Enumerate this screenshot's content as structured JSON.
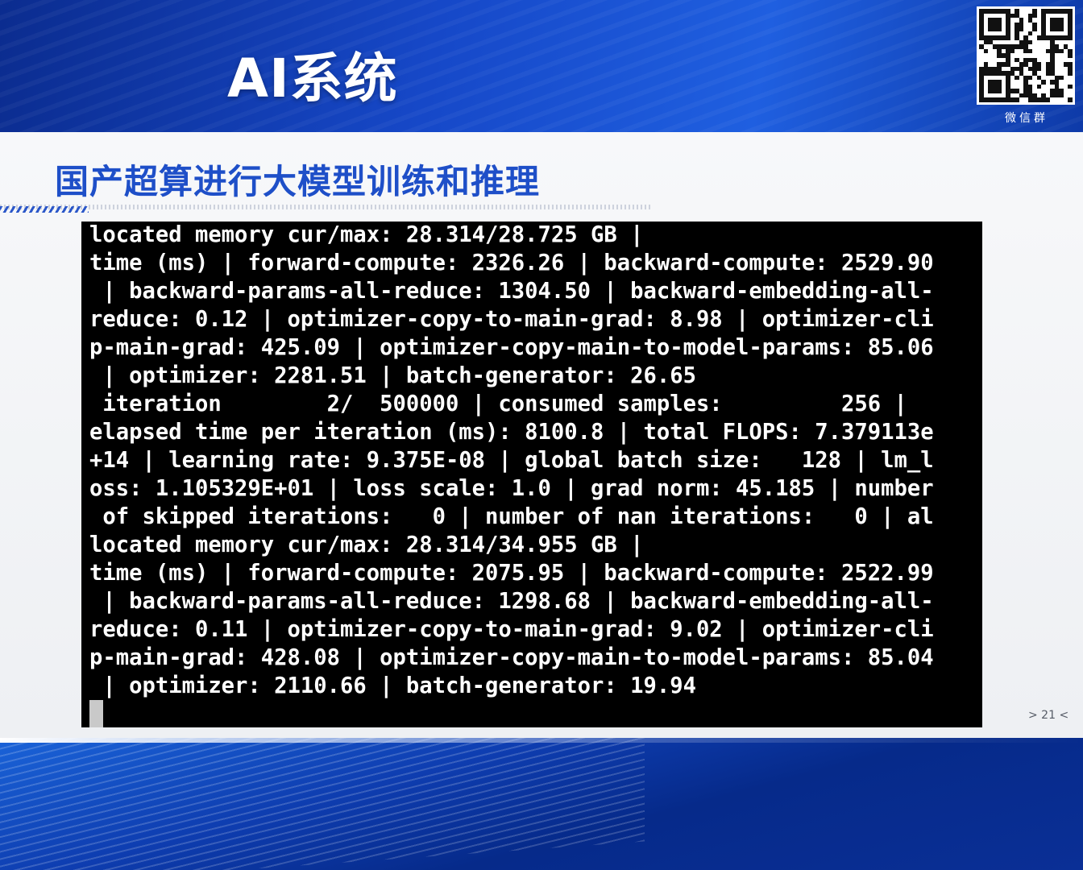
{
  "header": {
    "brand_title": "AI系统",
    "qr_caption": "微信群"
  },
  "slide": {
    "title": "国产超算进行大模型训练和推理",
    "page_number": "> 21 <"
  },
  "terminal": {
    "lines": [
      "located memory cur/max: 28.314/28.725 GB |",
      "time (ms) | forward-compute: 2326.26 | backward-compute: 2529.90",
      " | backward-params-all-reduce: 1304.50 | backward-embedding-all-",
      "reduce: 0.12 | optimizer-copy-to-main-grad: 8.98 | optimizer-cli",
      "p-main-grad: 425.09 | optimizer-copy-main-to-model-params: 85.06",
      " | optimizer: 2281.51 | batch-generator: 26.65",
      " iteration        2/  500000 | consumed samples:         256 |",
      "elapsed time per iteration (ms): 8100.8 | total FLOPS: 7.379113e",
      "+14 | learning rate: 9.375E-08 | global batch size:   128 | lm_l",
      "oss: 1.105329E+01 | loss scale: 1.0 | grad norm: 45.185 | number",
      " of skipped iterations:   0 | number of nan iterations:   0 | al",
      "located memory cur/max: 28.314/34.955 GB |",
      "time (ms) | forward-compute: 2075.95 | backward-compute: 2522.99",
      " | backward-params-all-reduce: 1298.68 | backward-embedding-all-",
      "reduce: 0.11 | optimizer-copy-to-main-grad: 9.02 | optimizer-cli",
      "p-main-grad: 428.08 | optimizer-copy-main-to-model-params: 85.04",
      " | optimizer: 2110.66 | batch-generator: 19.94"
    ]
  },
  "colors": {
    "title_blue": "#1e4fc8",
    "terminal_bg": "#000000",
    "terminal_text": "#ffffff"
  }
}
